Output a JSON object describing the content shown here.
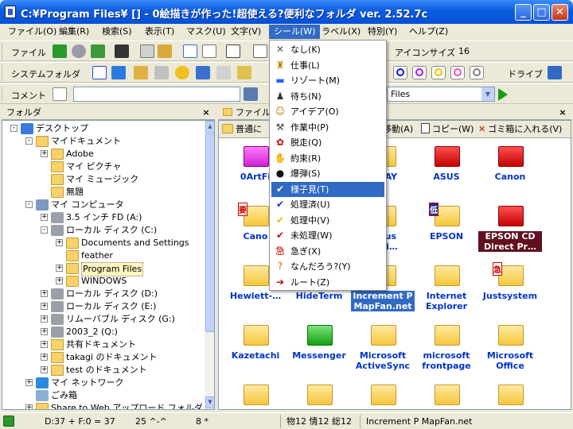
{
  "window": {
    "title": "C:¥Program Files¥ [] - 0絵描きが作った!超使える?便利なフォルダ ver. 2.52.7c"
  },
  "menu": [
    "ファイル(O)",
    "編集(R)",
    "検索(S)",
    "表示(T)",
    "マスク(U)",
    "文字(V)",
    "シール(W)",
    "ラベル(X)",
    "特別(Y)",
    "ヘルプ(Z)"
  ],
  "toolbar1": {
    "label": "ファイル",
    "icon_size_label": "アイコンサイズ",
    "icon_size_value": "16"
  },
  "toolbar2": {
    "label": "システムフォルダ",
    "drive_label": "ドライブ",
    "colors": [
      "#1010ff",
      "#a020f0",
      "#f0c000",
      "#f050c0",
      "#808080"
    ]
  },
  "toolbar3": {
    "comment_label": "コメント",
    "comment_value": "",
    "files_value": "Files"
  },
  "folder_pane": {
    "title": "フォルダ"
  },
  "tree": [
    {
      "label": "デスクトップ",
      "level": 0,
      "exp": "-",
      "icon": "desktop"
    },
    {
      "label": "マイドキュメント",
      "level": 1,
      "exp": "-",
      "icon": "folder"
    },
    {
      "label": "Adobe",
      "level": 2,
      "exp": "+",
      "icon": "folder"
    },
    {
      "label": "マイ ピクチャ",
      "level": 2,
      "exp": "",
      "icon": "folder"
    },
    {
      "label": "マイ ミュージック",
      "level": 2,
      "exp": "",
      "icon": "folder"
    },
    {
      "label": "無題",
      "level": 2,
      "exp": "",
      "icon": "folder"
    },
    {
      "label": "マイ コンピュータ",
      "level": 1,
      "exp": "-",
      "icon": "computer"
    },
    {
      "label": "3.5 インチ FD (A:)",
      "level": 2,
      "exp": "+",
      "icon": "drive"
    },
    {
      "label": "ローカル ディスク (C:)",
      "level": 2,
      "exp": "-",
      "icon": "drive"
    },
    {
      "label": "Documents and Settings",
      "level": 3,
      "exp": "+",
      "icon": "folder"
    },
    {
      "label": "feather",
      "level": 3,
      "exp": "",
      "icon": "folder"
    },
    {
      "label": "Program Files",
      "level": 3,
      "exp": "+",
      "icon": "folder",
      "selected": true
    },
    {
      "label": "WINDOWS",
      "level": 3,
      "exp": "+",
      "icon": "folder"
    },
    {
      "label": "ローカル ディスク (D:)",
      "level": 2,
      "exp": "+",
      "icon": "drive"
    },
    {
      "label": "ローカル ディスク (E:)",
      "level": 2,
      "exp": "+",
      "icon": "drive"
    },
    {
      "label": "リムーバブル ディスク (G:)",
      "level": 2,
      "exp": "+",
      "icon": "drive"
    },
    {
      "label": "2003_2 (Q:)",
      "level": 2,
      "exp": "+",
      "icon": "drive"
    },
    {
      "label": "共有ドキュメント",
      "level": 2,
      "exp": "+",
      "icon": "folder"
    },
    {
      "label": "takagi のドキュメント",
      "level": 2,
      "exp": "+",
      "icon": "folder"
    },
    {
      "label": "test のドキュメント",
      "level": 2,
      "exp": "+",
      "icon": "folder"
    },
    {
      "label": "マイ ネットワーク",
      "level": 1,
      "exp": "+",
      "icon": "network"
    },
    {
      "label": "ごみ箱",
      "level": 1,
      "exp": "",
      "icon": "trash"
    },
    {
      "label": "Share to Web アップロード フォルダ",
      "level": 1,
      "exp": "+",
      "icon": "folder"
    }
  ],
  "file_pane": {
    "title": "ファイル",
    "view_label": "普通に",
    "move_label": "移動(A)",
    "copy_label": "コピー(W)",
    "trash_label": "ゴミ箱に入れる(V)"
  },
  "files": [
    {
      "name": "0ArtFi",
      "color": "m",
      "row": 0,
      "col": 0
    },
    {
      "name": "HWAY",
      "color": "y",
      "row": 0,
      "col": 2
    },
    {
      "name": "ASUS",
      "color": "r",
      "row": 0,
      "col": 3
    },
    {
      "name": "Canon",
      "color": "r",
      "row": 0,
      "col": 4
    },
    {
      "name": "Cano",
      "color": "y",
      "row": 1,
      "col": 0,
      "badge": "要"
    },
    {
      "name": "nPlus\nicati…",
      "color": "y",
      "row": 1,
      "col": 2
    },
    {
      "name": "EPSON",
      "color": "y",
      "row": 1,
      "col": 3,
      "badge": "低"
    },
    {
      "name": "EPSON CD\nDirect Pr…",
      "color": "r",
      "row": 1,
      "col": 4,
      "dark": true
    },
    {
      "name": "Hewlett-…",
      "color": "y",
      "row": 2,
      "col": 0
    },
    {
      "name": "HideTerm",
      "color": "y",
      "row": 2,
      "col": 1
    },
    {
      "name": "Increment P\nMapFan.net",
      "color": "y",
      "row": 2,
      "col": 2,
      "selected": true
    },
    {
      "name": "Internet\nExplorer",
      "color": "y",
      "row": 2,
      "col": 3
    },
    {
      "name": "Justsystem",
      "color": "y",
      "row": 2,
      "col": 4,
      "badge": "急"
    },
    {
      "name": "Kazetachi",
      "color": "y",
      "row": 3,
      "col": 0
    },
    {
      "name": "Messenger",
      "color": "g",
      "row": 3,
      "col": 1
    },
    {
      "name": "Microsoft\nActiveSync",
      "color": "y",
      "row": 3,
      "col": 2
    },
    {
      "name": "microsoft\nfrontpage",
      "color": "y",
      "row": 3,
      "col": 3
    },
    {
      "name": "Microsoft\nOffice",
      "color": "y",
      "row": 3,
      "col": 4
    },
    {
      "name": "",
      "color": "y",
      "row": 4,
      "col": 0
    },
    {
      "name": "",
      "color": "y",
      "row": 4,
      "col": 1
    },
    {
      "name": "",
      "color": "y",
      "row": 4,
      "col": 2
    },
    {
      "name": "",
      "color": "y",
      "row": 4,
      "col": 3
    },
    {
      "name": "",
      "color": "y",
      "row": 4,
      "col": 4
    }
  ],
  "seal_menu": [
    {
      "label": "なし(K)",
      "icon": "✕",
      "color": "#555"
    },
    {
      "label": "仕事(L)",
      "icon": "♜",
      "color": "#c08000"
    },
    {
      "label": "リゾート(M)",
      "icon": "▬",
      "color": "#2060ff"
    },
    {
      "label": "待ち(N)",
      "icon": "♟",
      "color": "#333"
    },
    {
      "label": "アイデア(O)",
      "icon": "☺",
      "color": "#c08000"
    },
    {
      "label": "作業中(P)",
      "icon": "⚒",
      "color": "#444"
    },
    {
      "label": "脱走(Q)",
      "icon": "✿",
      "color": "#c00"
    },
    {
      "label": "約束(R)",
      "icon": "✋",
      "color": "#333"
    },
    {
      "label": "爆弾(S)",
      "icon": "●",
      "color": "#111"
    },
    {
      "label": "様子見(T)",
      "icon": "✔",
      "color": "#000",
      "selected": true
    },
    {
      "label": "処理済(U)",
      "icon": "✔",
      "color": "#1030d0"
    },
    {
      "label": "処理中(V)",
      "icon": "✔",
      "color": "#e0c000"
    },
    {
      "label": "未処理(W)",
      "icon": "✔",
      "color": "#d00000"
    },
    {
      "label": "急ぎ(X)",
      "icon": "急",
      "color": "#d00000"
    },
    {
      "label": "なんだろう?(Y)",
      "icon": "?",
      "color": "#d06000"
    },
    {
      "label": "ルート(Z)",
      "icon": "➔",
      "color": "#c00000"
    }
  ],
  "status": {
    "counts": "D:37 + F:0 = 37",
    "face": "25 ^-^",
    "star": "8 *",
    "info": "物12 情12 総12",
    "selected_name": "Increment P MapFan.net"
  }
}
